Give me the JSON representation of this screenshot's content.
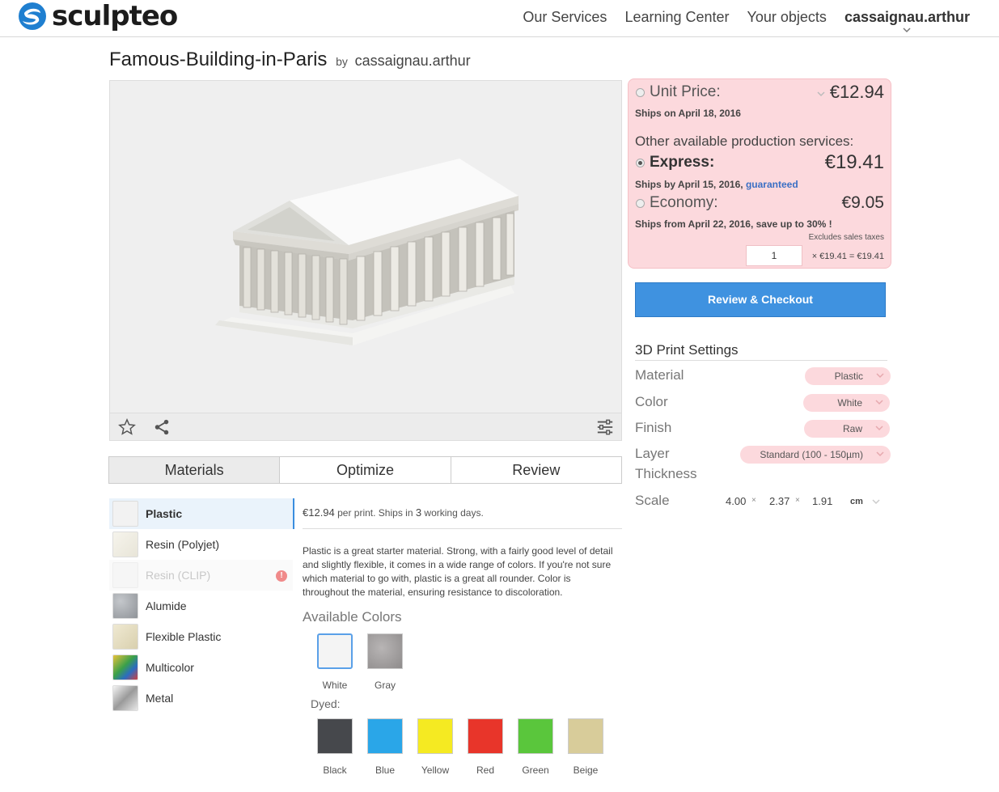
{
  "header": {
    "logo_text": "sculpteo",
    "nav": [
      "Our Services",
      "Learning Center",
      "Your objects"
    ],
    "user": "cassaignau.arthur"
  },
  "page": {
    "title": "Famous-Building-in-Paris",
    "by": "by",
    "author": "cassaignau.arthur"
  },
  "tabs": [
    "Materials",
    "Optimize",
    "Review"
  ],
  "materials": [
    {
      "label": "Plastic",
      "swatch": "#f2f2f2",
      "state": "selected"
    },
    {
      "label": "Resin (Polyjet)",
      "swatch": "#f1efe6",
      "state": "normal"
    },
    {
      "label": "Resin (CLIP)",
      "swatch": "#f6f6f6",
      "state": "disabled",
      "warning": "!"
    },
    {
      "label": "Alumide",
      "swatch": "#a9adb2",
      "state": "normal"
    },
    {
      "label": "Flexible Plastic",
      "swatch": "#e6dfc6",
      "state": "normal"
    },
    {
      "label": "Multicolor",
      "swatch": "#5a9b4a",
      "state": "normal"
    },
    {
      "label": "Metal",
      "swatch": "#d0d0d0",
      "state": "normal"
    }
  ],
  "detail": {
    "price": "€12.94",
    "price_rest": "per print. Ships in",
    "days": "3",
    "days_rest": "working days.",
    "description": "Plastic is a great starter material. Strong, with a fairly good level of detail and slightly flexible, it comes in a wide range of colors. If you're not sure which material to go with, plastic is a great all rounder. Color is throughout the material, ensuring resistance to discoloration.",
    "available_colors": "Available Colors",
    "colors": [
      {
        "label": "White",
        "hex": "#f4f4f4",
        "selected": true
      },
      {
        "label": "Gray",
        "hex": "#9c9a9a",
        "selected": false
      }
    ],
    "dyed_label": "Dyed:",
    "dyed": [
      {
        "label": "Black",
        "hex": "#46484c"
      },
      {
        "label": "Blue",
        "hex": "#2aa6e8"
      },
      {
        "label": "Yellow",
        "hex": "#f5ea22"
      },
      {
        "label": "Red",
        "hex": "#e8352a"
      },
      {
        "label": "Green",
        "hex": "#5ac63c"
      },
      {
        "label": "Beige",
        "hex": "#d8cc9a"
      }
    ]
  },
  "pricing": {
    "unit_label": "Unit Price:",
    "unit_price": "€12.94",
    "unit_ship": "Ships on April 18, 2016",
    "other_label": "Other available production services:",
    "express_label": "Express:",
    "express_price": "€19.41",
    "express_ship": "Ships by April 15, 2016,",
    "guaranteed": "guaranteed",
    "economy_label": "Economy:",
    "economy_price": "€9.05",
    "economy_ship": "Ships from April 22, 2016, save up to 30% !",
    "excludes": "Excludes sales taxes",
    "quantity": "1",
    "total": "× €19.41 = €19.41"
  },
  "checkout_label": "Review & Checkout",
  "settings": {
    "title": "3D Print Settings",
    "material_label": "Material",
    "material_value": "Plastic",
    "color_label": "Color",
    "color_value": "White",
    "finish_label": "Finish",
    "finish_value": "Raw",
    "layer_label": "Layer",
    "layer_label2": "Thickness",
    "layer_value": "Standard (100 - 150µm)",
    "scale_label": "Scale",
    "scale_x": "4.00",
    "scale_y": "2.37",
    "scale_z": "1.91",
    "times": "×",
    "unit": "cm"
  },
  "colors": {
    "accent": "#3f92e0",
    "pink": "#fcd9dd",
    "link": "#3a6fc4"
  }
}
